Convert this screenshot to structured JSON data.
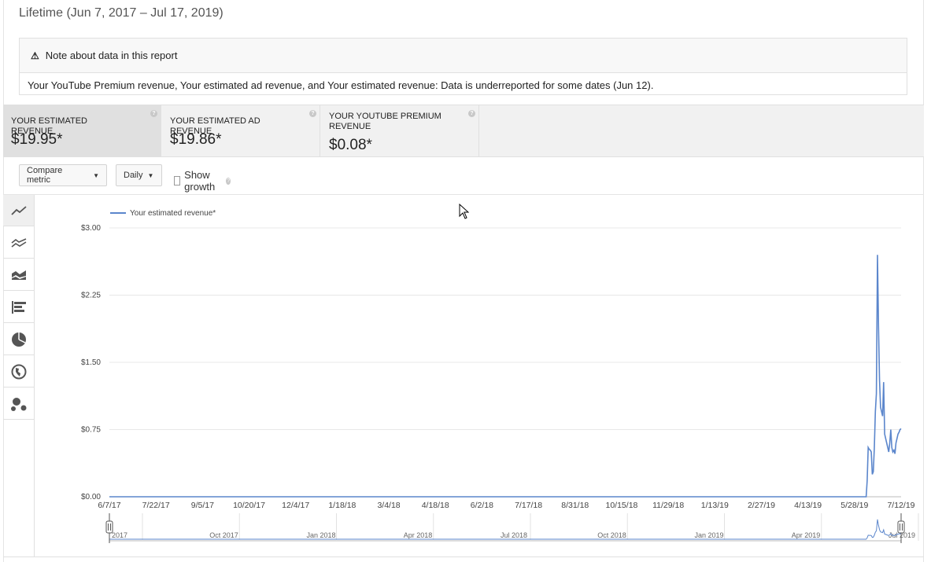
{
  "period": "Lifetime (Jun 7, 2017 – Jul 17, 2019)",
  "note": {
    "icon": "warning-icon",
    "title": "Note about data in this report",
    "body": "Your YouTube Premium revenue, Your estimated ad revenue, and Your estimated revenue: Data is underreported for some dates (Jun 12)."
  },
  "metrics": [
    {
      "label": "YOUR ESTIMATED REVENUE",
      "value": "$19.95*",
      "active": true
    },
    {
      "label": "YOUR ESTIMATED AD REVENUE",
      "value": "$19.86*",
      "active": false
    },
    {
      "label": "YOUR YOUTUBE PREMIUM REVENUE",
      "value": "$0.08*",
      "active": false
    }
  ],
  "toolbar": {
    "compare_label": "Compare metric",
    "interval_label": "Daily",
    "show_growth_label": "Show growth",
    "show_growth_checked": false
  },
  "sidebar_icons": [
    "line-chart-icon",
    "multi-line-chart-icon",
    "stacked-area-chart-icon",
    "bar-chart-icon",
    "pie-chart-icon",
    "globe-map-icon",
    "bubble-chart-icon"
  ],
  "chart_data": {
    "type": "line",
    "legend": [
      "Your estimated revenue*"
    ],
    "legend_position": "top-left",
    "ylim": [
      0,
      3
    ],
    "y_ticks": [
      "$0.00",
      "$0.75",
      "$1.50",
      "$2.25",
      "$3.00"
    ],
    "x_ticks": [
      "6/7/17",
      "7/22/17",
      "9/5/17",
      "10/20/17",
      "12/4/17",
      "1/18/18",
      "3/4/18",
      "4/18/18",
      "6/2/18",
      "7/17/18",
      "8/31/18",
      "10/15/18",
      "11/29/18",
      "1/13/19",
      "2/27/19",
      "4/13/19",
      "5/28/19",
      "7/12/19"
    ],
    "color": "#5b86cc",
    "grid": true,
    "series": [
      {
        "name": "Your estimated revenue*",
        "x": [
          "2017-06-07",
          "2019-06-13",
          "2019-06-14",
          "2019-06-15",
          "2019-06-16",
          "2019-06-17",
          "2019-06-18",
          "2019-06-19",
          "2019-06-20",
          "2019-06-21",
          "2019-06-22",
          "2019-06-23",
          "2019-06-24",
          "2019-06-25",
          "2019-06-26",
          "2019-06-27",
          "2019-06-28",
          "2019-06-29",
          "2019-06-30",
          "2019-07-01",
          "2019-07-02",
          "2019-07-03",
          "2019-07-04",
          "2019-07-05",
          "2019-07-06",
          "2019-07-07",
          "2019-07-08",
          "2019-07-09",
          "2019-07-10",
          "2019-07-11",
          "2019-07-12",
          "2019-07-13",
          "2019-07-14",
          "2019-07-15",
          "2019-07-16",
          "2019-07-17"
        ],
        "values": [
          0,
          0,
          0.18,
          0.55,
          0.53,
          0.52,
          0.5,
          0.25,
          0.28,
          0.55,
          0.95,
          1.15,
          2.7,
          1.9,
          1.3,
          1.0,
          0.95,
          0.9,
          1.28,
          0.7,
          0.65,
          0.6,
          0.55,
          0.5,
          0.6,
          0.75,
          0.55,
          0.5,
          0.52,
          0.48,
          0.6,
          0.65,
          0.7,
          0.72,
          0.75,
          0.76
        ]
      }
    ],
    "navigator": {
      "labels": [
        "2017",
        "Oct 2017",
        "Jan 2018",
        "Apr 2018",
        "Jul 2018",
        "Oct 2018",
        "Jan 2019",
        "Apr 2019",
        "Jul 2019"
      ]
    }
  }
}
